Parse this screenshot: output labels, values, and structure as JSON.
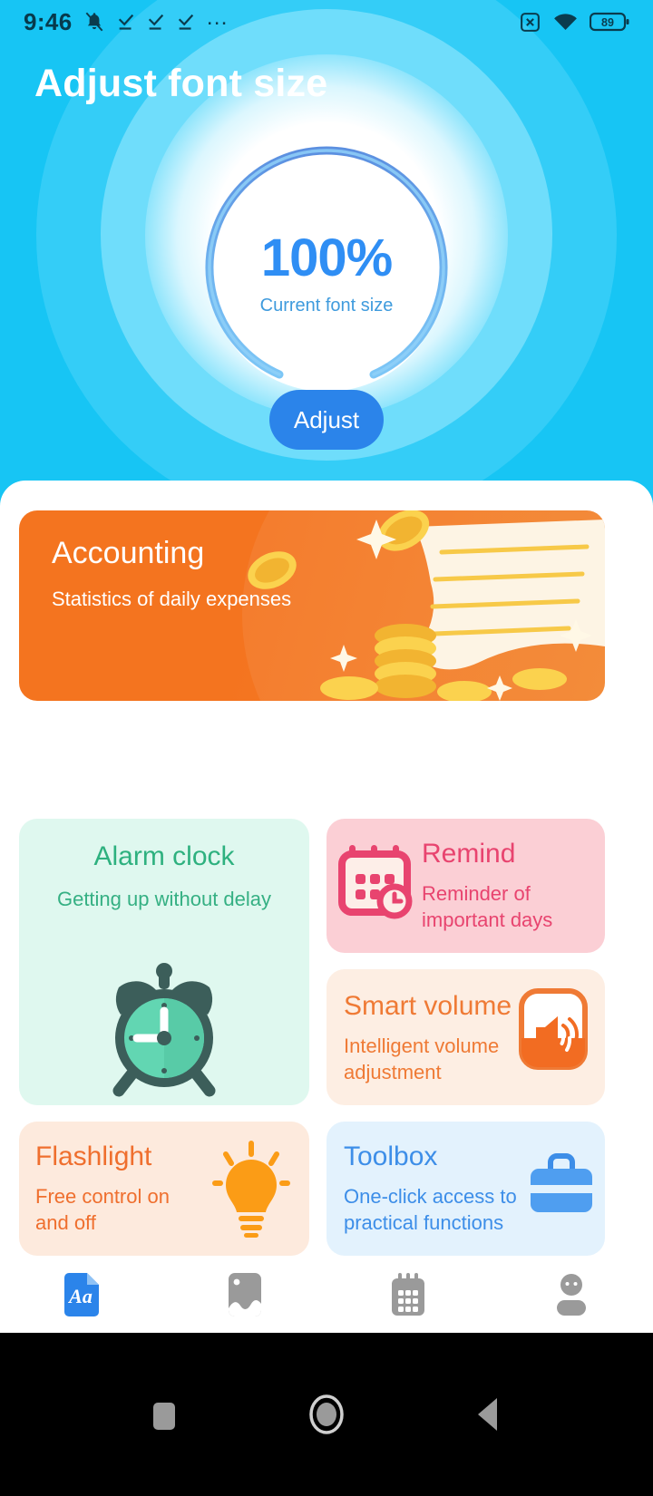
{
  "status_bar": {
    "time": "9:46",
    "icons_left": [
      "mute-bell-icon",
      "check-download-icon",
      "check-download-icon",
      "check-download-icon",
      "more-dots-icon"
    ],
    "icons_right": [
      "sim-missing-icon",
      "wifi-icon",
      "battery-icon"
    ],
    "battery_level": "89"
  },
  "header": {
    "title": "Adjust font size",
    "gauge": {
      "value": "100%",
      "label": "Current font size",
      "percent": 100,
      "accent": "#2f8ef4"
    },
    "adjust_button": "Adjust"
  },
  "banner": {
    "title": "Accounting",
    "subtitle": "Statistics of daily expenses",
    "color": "#f4741f",
    "illustration": "coins-receipt-illustration"
  },
  "cards": [
    {
      "id": "alarm-clock",
      "title": "Alarm clock",
      "subtitle": "Getting up without delay",
      "bg": "#dff8ef",
      "fg": "#2eb17f",
      "icon": "alarm-clock-icon"
    },
    {
      "id": "remind",
      "title": "Remind",
      "subtitle": "Reminder of important days",
      "bg": "#fbcfd5",
      "fg": "#e8446f",
      "icon": "calendar-clock-icon"
    },
    {
      "id": "smart-volume",
      "title": "Smart volume",
      "subtitle": "Intelligent volume adjustment",
      "bg": "#fdeee3",
      "fg": "#ef7a35",
      "icon": "speaker-volume-icon"
    },
    {
      "id": "flashlight",
      "title": "Flashlight",
      "subtitle": "Free control on and off",
      "bg": "#fdeadd",
      "fg": "#ef6f2e",
      "icon": "lightbulb-icon"
    },
    {
      "id": "toolbox",
      "title": "Toolbox",
      "subtitle": "One-click access to practical functions",
      "bg": "#e3f2fd",
      "fg": "#3d8ee8",
      "icon": "toolbox-icon"
    }
  ],
  "tabbar": {
    "items": [
      {
        "id": "font",
        "icon": "font-document-icon",
        "active": true
      },
      {
        "id": "photo",
        "icon": "photo-image-icon",
        "active": false
      },
      {
        "id": "calendar",
        "icon": "calendar-grid-icon",
        "active": false
      },
      {
        "id": "profile",
        "icon": "person-profile-icon",
        "active": false
      }
    ],
    "active_color": "#2b84ea",
    "inactive_color": "#9a9a9a"
  },
  "system_nav": {
    "buttons": [
      "recents-square-icon",
      "home-circle-icon",
      "back-triangle-icon"
    ]
  }
}
